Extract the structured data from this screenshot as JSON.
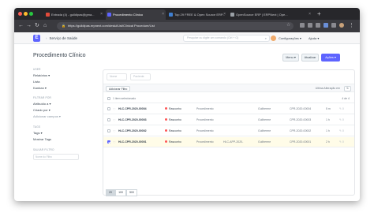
{
  "browser": {
    "tabs": [
      {
        "title": "Entrada (4) - guildipas@gma..."
      },
      {
        "title": "Procedimento Clínico"
      },
      {
        "title": "Top 29 FREE & Open Source ERP..."
      },
      {
        "title": "OpenSource ERP | ERPNext | Ope..."
      }
    ],
    "url": "https://guildipas.erpnext.com/desk#List/Clinical Procedure/List"
  },
  "navbar": {
    "logo": "E",
    "breadcrumb": "Serviço de Saúde",
    "search_placeholder": "Pesquise ou digite um comando (Ctrl + G)",
    "settings_label": "Configurações",
    "help_label": "Ajuda"
  },
  "page": {
    "title": "Procedimento Clínico",
    "menu_label": "Menu",
    "refresh_label": "Atualizar",
    "actions_label": "Ações"
  },
  "sidebar": {
    "user_heading": "USER",
    "reports_label": "Relatórios",
    "list_label": "Lista",
    "kanban_label": "Kanban",
    "filters_heading": "FILTRAR POR",
    "assigned_label": "Atribuído a",
    "created_label": "Criado por",
    "add_fields_label": "Adicionar campos",
    "tags_heading": "TAGS",
    "tags_label": "Tags",
    "show_tags_label": "Mostrar Tags",
    "save_filter_heading": "SALVAR FILTRO",
    "filter_name_placeholder": "Nome do Filtro"
  },
  "list": {
    "filter_placeholder_1": "Nome",
    "filter_placeholder_2": "Paciente",
    "add_filter_label": "Adicionar Filtro",
    "sort_label": "Ultima Alteração em",
    "selected_text": "1 item selecionado",
    "count_text": "4 de 4",
    "rows": [
      {
        "name": "HLC-CPR-2020-00004",
        "status": "Rascunho",
        "type": "Procedimento",
        "practitioner": "Guilherme",
        "appointment": "",
        "patient": "CPR-2020-00004",
        "age": "5 m",
        "comments": "0"
      },
      {
        "name": "HLC-CPR-2020-00003",
        "status": "Rascunho",
        "type": "Procedimento",
        "practitioner": "Guilherme",
        "appointment": "",
        "patient": "CPR-2020-00003",
        "age": "1 h",
        "comments": "0"
      },
      {
        "name": "HLC-CPR-2020-00002",
        "status": "Rascunho",
        "type": "Procedimento",
        "practitioner": "Guilherme",
        "appointment": "",
        "patient": "CPR-2020-00002",
        "age": "1 h",
        "comments": "0"
      },
      {
        "name": "HLC-CPR-2020-00001",
        "status": "Rascunho",
        "type": "Procedimento",
        "practitioner": "Guilherme",
        "appointment": "HLC-APP-2020-",
        "patient": "CPR-2020-00001",
        "age": "2 h",
        "comments": "0"
      }
    ],
    "page_sizes": [
      "20",
      "100",
      "500"
    ]
  },
  "colors": {
    "primary": "#5e64ff",
    "draft_dot": "#ff5858",
    "selected_row": "#fffce8"
  }
}
